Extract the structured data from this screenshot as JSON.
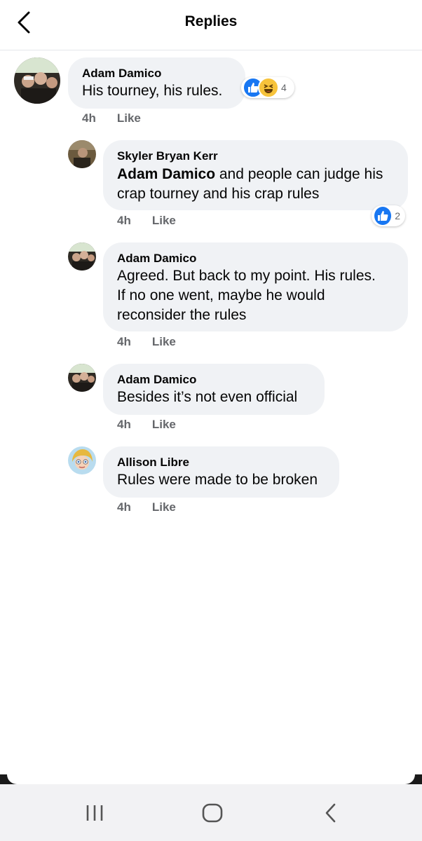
{
  "header": {
    "title": "Replies",
    "back_icon": "chevron-left-icon"
  },
  "comments": [
    {
      "author": "Adam Damico",
      "text": "His tourney, his rules.",
      "time": "4h",
      "like_label": "Like",
      "reactions": {
        "icons": [
          "like-icon",
          "haha-icon"
        ],
        "count": "4"
      }
    },
    {
      "author": "Skyler Bryan Kerr",
      "mention": "Adam Damico",
      "text_line1": " and people can judge his",
      "text_line2": "crap tourney and his crap rules",
      "time": "4h",
      "like_label": "Like",
      "reactions": {
        "icons": [
          "like-icon"
        ],
        "count": "2"
      }
    },
    {
      "author": "Adam Damico",
      "text_lines": [
        "Agreed. But back to my point. His rules.",
        "If no one went, maybe he would",
        "reconsider the rules"
      ],
      "time": "4h",
      "like_label": "Like"
    },
    {
      "author": "Adam Damico",
      "text": "Besides it’s not even official",
      "time": "4h",
      "like_label": "Like"
    },
    {
      "author": "Allison Libre",
      "text": "Rules were made to be broken",
      "time": "4h",
      "like_label": "Like"
    }
  ],
  "system_nav": {
    "recents_icon": "recents-icon",
    "home_icon": "home-icon",
    "back_icon": "back-icon"
  },
  "colors": {
    "bubble": "#f0f2f5",
    "meta_text": "#65676b",
    "like_blue": "#1877f2",
    "haha_yellow": "#f7c33b",
    "nav_bg": "#f2f2f4"
  }
}
